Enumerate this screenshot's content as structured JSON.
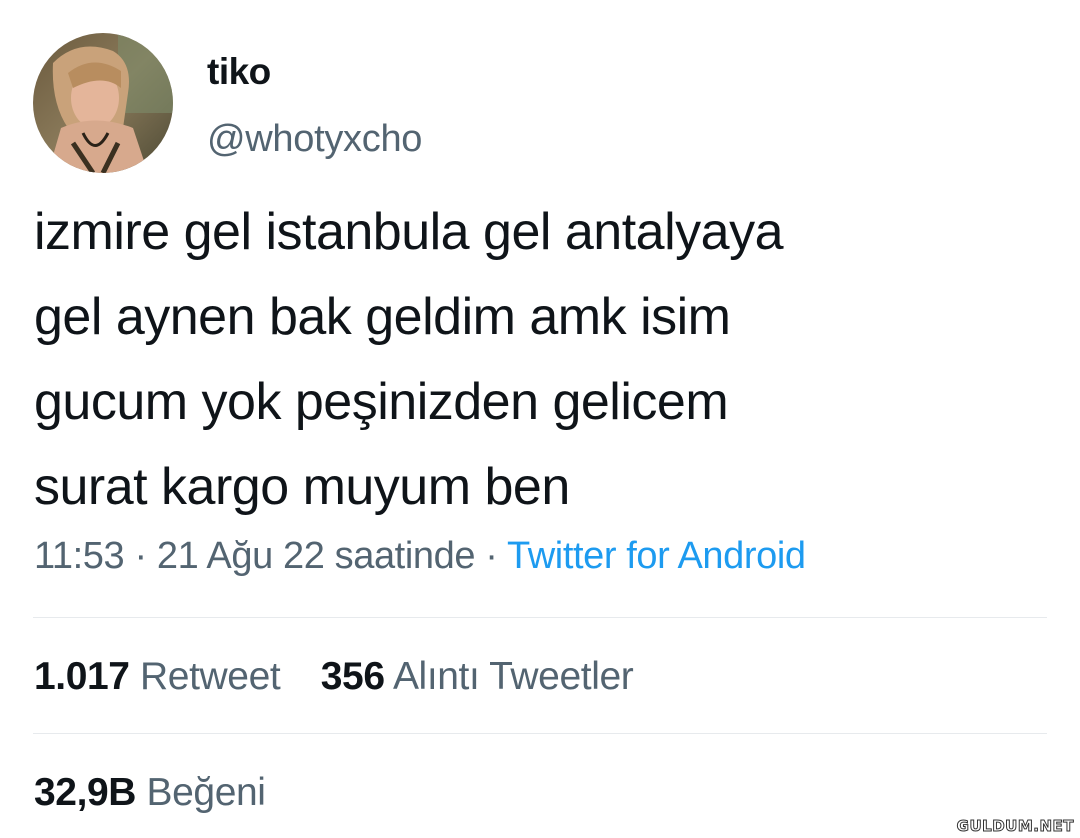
{
  "author": {
    "display_name": "tiko",
    "handle": "@whotyxcho",
    "avatar_icon": "profile-photo"
  },
  "tweet": {
    "lines": [
      "izmire gel istanbula gel antalyaya",
      "gel aynen bak geldim amk isim",
      "gucum yok peşinizden gelicem",
      "surat kargo muyum ben"
    ],
    "time": "11:53",
    "separator": "·",
    "date": "21 Ağu 22 saatinde",
    "source": "Twitter for Android"
  },
  "stats": {
    "retweets_count": "1.017",
    "retweets_label": "Retweet",
    "quotes_count": "356",
    "quotes_label": "Alıntı Tweetler",
    "likes_count": "32,9B",
    "likes_label": "Beğeni"
  },
  "watermark": "GULDUM.NET",
  "colors": {
    "text": "#0f1419",
    "secondary": "#536471",
    "link": "#1d9bf0",
    "divider": "#e7eaed"
  }
}
